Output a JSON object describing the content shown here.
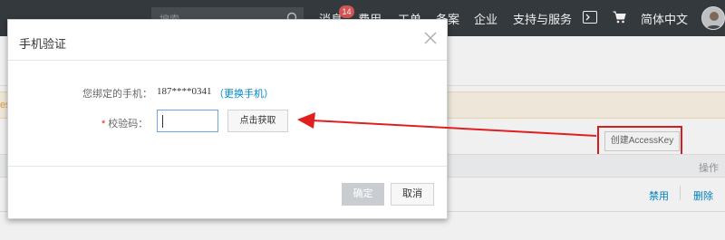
{
  "topbar": {
    "search_placeholder": "搜索",
    "nav": {
      "messages": "消息",
      "messages_badge": "14",
      "billing": "费用",
      "tickets": "工单",
      "icp": "备案",
      "enterprise": "企业",
      "support": "支持与服务",
      "language": "简体中文"
    },
    "icons": [
      "search-icon",
      "terminal-icon",
      "cart-icon",
      "avatar"
    ]
  },
  "background": {
    "warning_fragment": "ess",
    "create_key_label": "创建AccessKey",
    "table": {
      "operation_header": "操作",
      "row_actions": {
        "disable": "禁用",
        "delete": "删除"
      }
    }
  },
  "dialog": {
    "title": "手机验证",
    "bound_phone_label": "您绑定的手机：",
    "phone_number": "187****0341",
    "change_phone_link": "更换手机",
    "code_label": "校验码：",
    "code_value": "",
    "get_code_button": "点击获取",
    "confirm_button": "确定",
    "cancel_button": "取消"
  },
  "colors": {
    "topbar": "#373d41",
    "link": "#0088cc",
    "annotation_red": "#e02020",
    "badge": "#e05a5a"
  }
}
